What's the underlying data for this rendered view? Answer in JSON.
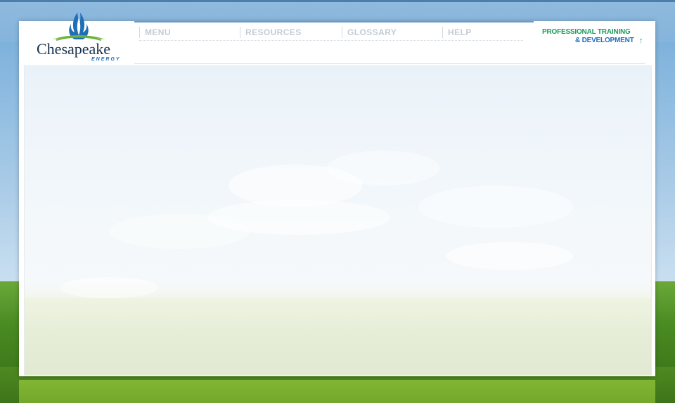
{
  "brand": {
    "logo_name": "Chesapeake",
    "logo_sub": "ENERGY"
  },
  "nav": {
    "items": [
      {
        "label": "MENU"
      },
      {
        "label": "RESOURCES"
      },
      {
        "label": "GLOSSARY"
      },
      {
        "label": "HELP"
      }
    ]
  },
  "program": {
    "line1": "PROFESSIONAL TRAINING",
    "line2": "& DEVELOPMENT",
    "arrow": "↑"
  },
  "colors": {
    "nav_text": "#c3ccd4",
    "accent_green": "#1c9a5c",
    "accent_blue": "#1f6eb8",
    "footer_green": "#7ab02f"
  }
}
